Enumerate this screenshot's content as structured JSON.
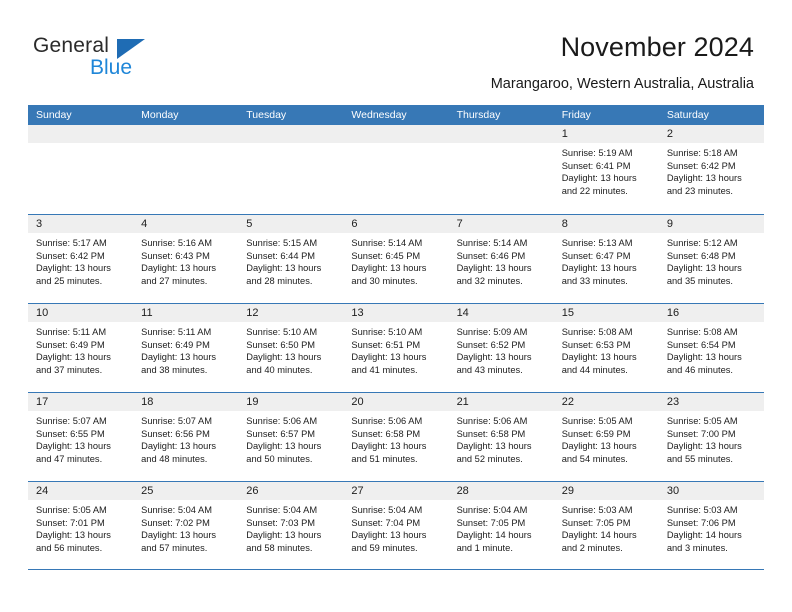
{
  "brand": {
    "name_part1": "General",
    "name_part2": "Blue",
    "logo_icon": "triangle-flag-icon"
  },
  "header": {
    "title": "November 2024",
    "location": "Marangaroo, Western Australia, Australia"
  },
  "colors": {
    "header_blue": "#3778b6",
    "brand_dark_blue": "#1f6cb4",
    "brand_light_blue": "#1f86d8",
    "day_band_gray": "#efefef"
  },
  "weekdays": [
    "Sunday",
    "Monday",
    "Tuesday",
    "Wednesday",
    "Thursday",
    "Friday",
    "Saturday"
  ],
  "labels": {
    "sunrise_prefix": "Sunrise:",
    "sunset_prefix": "Sunset:",
    "daylight_prefix": "Daylight:"
  },
  "weeks": [
    [
      {
        "empty": true
      },
      {
        "empty": true
      },
      {
        "empty": true
      },
      {
        "empty": true
      },
      {
        "empty": true
      },
      {
        "day": "1",
        "sunrise": "Sunrise: 5:19 AM",
        "sunset": "Sunset: 6:41 PM",
        "daylight": "Daylight: 13 hours and 22 minutes."
      },
      {
        "day": "2",
        "sunrise": "Sunrise: 5:18 AM",
        "sunset": "Sunset: 6:42 PM",
        "daylight": "Daylight: 13 hours and 23 minutes."
      }
    ],
    [
      {
        "day": "3",
        "sunrise": "Sunrise: 5:17 AM",
        "sunset": "Sunset: 6:42 PM",
        "daylight": "Daylight: 13 hours and 25 minutes."
      },
      {
        "day": "4",
        "sunrise": "Sunrise: 5:16 AM",
        "sunset": "Sunset: 6:43 PM",
        "daylight": "Daylight: 13 hours and 27 minutes."
      },
      {
        "day": "5",
        "sunrise": "Sunrise: 5:15 AM",
        "sunset": "Sunset: 6:44 PM",
        "daylight": "Daylight: 13 hours and 28 minutes."
      },
      {
        "day": "6",
        "sunrise": "Sunrise: 5:14 AM",
        "sunset": "Sunset: 6:45 PM",
        "daylight": "Daylight: 13 hours and 30 minutes."
      },
      {
        "day": "7",
        "sunrise": "Sunrise: 5:14 AM",
        "sunset": "Sunset: 6:46 PM",
        "daylight": "Daylight: 13 hours and 32 minutes."
      },
      {
        "day": "8",
        "sunrise": "Sunrise: 5:13 AM",
        "sunset": "Sunset: 6:47 PM",
        "daylight": "Daylight: 13 hours and 33 minutes."
      },
      {
        "day": "9",
        "sunrise": "Sunrise: 5:12 AM",
        "sunset": "Sunset: 6:48 PM",
        "daylight": "Daylight: 13 hours and 35 minutes."
      }
    ],
    [
      {
        "day": "10",
        "sunrise": "Sunrise: 5:11 AM",
        "sunset": "Sunset: 6:49 PM",
        "daylight": "Daylight: 13 hours and 37 minutes."
      },
      {
        "day": "11",
        "sunrise": "Sunrise: 5:11 AM",
        "sunset": "Sunset: 6:49 PM",
        "daylight": "Daylight: 13 hours and 38 minutes."
      },
      {
        "day": "12",
        "sunrise": "Sunrise: 5:10 AM",
        "sunset": "Sunset: 6:50 PM",
        "daylight": "Daylight: 13 hours and 40 minutes."
      },
      {
        "day": "13",
        "sunrise": "Sunrise: 5:10 AM",
        "sunset": "Sunset: 6:51 PM",
        "daylight": "Daylight: 13 hours and 41 minutes."
      },
      {
        "day": "14",
        "sunrise": "Sunrise: 5:09 AM",
        "sunset": "Sunset: 6:52 PM",
        "daylight": "Daylight: 13 hours and 43 minutes."
      },
      {
        "day": "15",
        "sunrise": "Sunrise: 5:08 AM",
        "sunset": "Sunset: 6:53 PM",
        "daylight": "Daylight: 13 hours and 44 minutes."
      },
      {
        "day": "16",
        "sunrise": "Sunrise: 5:08 AM",
        "sunset": "Sunset: 6:54 PM",
        "daylight": "Daylight: 13 hours and 46 minutes."
      }
    ],
    [
      {
        "day": "17",
        "sunrise": "Sunrise: 5:07 AM",
        "sunset": "Sunset: 6:55 PM",
        "daylight": "Daylight: 13 hours and 47 minutes."
      },
      {
        "day": "18",
        "sunrise": "Sunrise: 5:07 AM",
        "sunset": "Sunset: 6:56 PM",
        "daylight": "Daylight: 13 hours and 48 minutes."
      },
      {
        "day": "19",
        "sunrise": "Sunrise: 5:06 AM",
        "sunset": "Sunset: 6:57 PM",
        "daylight": "Daylight: 13 hours and 50 minutes."
      },
      {
        "day": "20",
        "sunrise": "Sunrise: 5:06 AM",
        "sunset": "Sunset: 6:58 PM",
        "daylight": "Daylight: 13 hours and 51 minutes."
      },
      {
        "day": "21",
        "sunrise": "Sunrise: 5:06 AM",
        "sunset": "Sunset: 6:58 PM",
        "daylight": "Daylight: 13 hours and 52 minutes."
      },
      {
        "day": "22",
        "sunrise": "Sunrise: 5:05 AM",
        "sunset": "Sunset: 6:59 PM",
        "daylight": "Daylight: 13 hours and 54 minutes."
      },
      {
        "day": "23",
        "sunrise": "Sunrise: 5:05 AM",
        "sunset": "Sunset: 7:00 PM",
        "daylight": "Daylight: 13 hours and 55 minutes."
      }
    ],
    [
      {
        "day": "24",
        "sunrise": "Sunrise: 5:05 AM",
        "sunset": "Sunset: 7:01 PM",
        "daylight": "Daylight: 13 hours and 56 minutes."
      },
      {
        "day": "25",
        "sunrise": "Sunrise: 5:04 AM",
        "sunset": "Sunset: 7:02 PM",
        "daylight": "Daylight: 13 hours and 57 minutes."
      },
      {
        "day": "26",
        "sunrise": "Sunrise: 5:04 AM",
        "sunset": "Sunset: 7:03 PM",
        "daylight": "Daylight: 13 hours and 58 minutes."
      },
      {
        "day": "27",
        "sunrise": "Sunrise: 5:04 AM",
        "sunset": "Sunset: 7:04 PM",
        "daylight": "Daylight: 13 hours and 59 minutes."
      },
      {
        "day": "28",
        "sunrise": "Sunrise: 5:04 AM",
        "sunset": "Sunset: 7:05 PM",
        "daylight": "Daylight: 14 hours and 1 minute."
      },
      {
        "day": "29",
        "sunrise": "Sunrise: 5:03 AM",
        "sunset": "Sunset: 7:05 PM",
        "daylight": "Daylight: 14 hours and 2 minutes."
      },
      {
        "day": "30",
        "sunrise": "Sunrise: 5:03 AM",
        "sunset": "Sunset: 7:06 PM",
        "daylight": "Daylight: 14 hours and 3 minutes."
      }
    ]
  ]
}
